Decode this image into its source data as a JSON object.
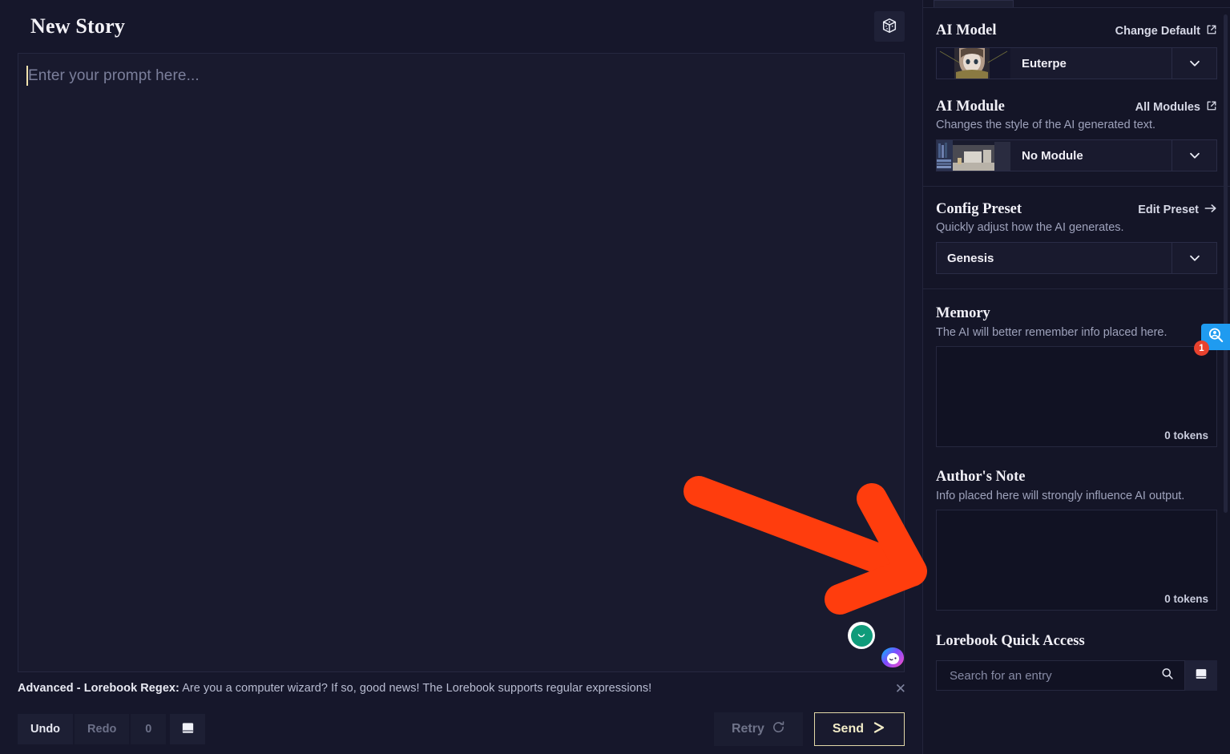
{
  "story": {
    "title": "New Story",
    "prompt_value": "",
    "prompt_placeholder": "Enter your prompt here...",
    "dice_icon": "dice-cube-icon",
    "mood_icon": "smiley-mood-icon",
    "assistant_icon": "gradient-blob-icon"
  },
  "notification": {
    "label": "Advanced - Lorebook Regex:",
    "message": "Are you a computer wizard? If so, good news! The Lorebook supports regular expressions!",
    "close_icon": "close-icon"
  },
  "toolbar": {
    "undo_label": "Undo",
    "redo_label": "Redo",
    "count": "0",
    "lorebook_icon": "book-icon",
    "retry_label": "Retry",
    "retry_icon": "refresh-icon",
    "send_label": "Send",
    "send_icon": "send-arrow-icon",
    "send_border_color": "#e3d9a8",
    "send_text_color": "#f2ecc8"
  },
  "sidebar": {
    "ai_model": {
      "title": "AI Model",
      "action": "Change Default",
      "action_icon": "external-link-icon",
      "selected": "Euterpe",
      "chevron_icon": "chevron-down-icon",
      "thumb": "anime-portrait-thumbnail"
    },
    "ai_module": {
      "title": "AI Module",
      "action": "All Modules",
      "action_icon": "external-link-icon",
      "description": "Changes the style of the AI generated text.",
      "selected": "No Module",
      "chevron_icon": "chevron-down-icon",
      "thumb": "desk-library-thumbnail"
    },
    "config_preset": {
      "title": "Config Preset",
      "action": "Edit Preset",
      "action_icon": "arrow-right-icon",
      "description": "Quickly adjust how the AI generates.",
      "selected": "Genesis",
      "chevron_icon": "chevron-down-icon"
    },
    "memory": {
      "title": "Memory",
      "description": "The AI will better remember info placed here.",
      "value": "",
      "tokens": "0 tokens"
    },
    "authors_note": {
      "title": "Author's Note",
      "description": "Info placed here will strongly influence AI output.",
      "value": "",
      "tokens": "0 tokens"
    },
    "lorebook": {
      "title": "Lorebook Quick Access",
      "search_placeholder": "Search for an entry",
      "search_value": "",
      "search_icon": "magnifier-icon",
      "add_icon": "book-icon"
    },
    "floating_badge": {
      "icon": "user-search-icon",
      "count": "1",
      "color": "#1f9bf0",
      "badge_color": "#e8422e"
    }
  },
  "annotation": {
    "arrow_color": "#ff3d0d",
    "arrow_name": "orange-pointer-arrow"
  }
}
